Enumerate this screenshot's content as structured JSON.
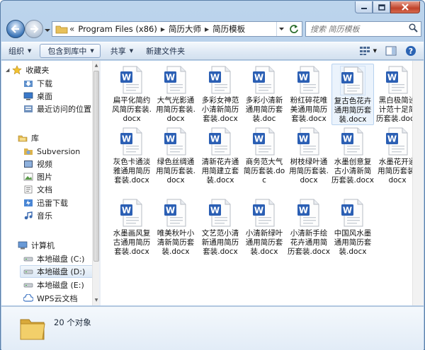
{
  "window": {
    "caption": {
      "minimize": "minimize",
      "maximize": "maximize",
      "close": "close"
    }
  },
  "address": {
    "segments": [
      "Program Files (x86)",
      "简历大师",
      "简历模板"
    ],
    "overflow": "«"
  },
  "search": {
    "placeholder": "搜索 简历模板"
  },
  "toolbar": {
    "organize": "组织",
    "include_in_library": "包含到库中",
    "share": "共享",
    "new_folder": "新建文件夹"
  },
  "nav": {
    "favorites": "收藏夹",
    "downloads": "下载",
    "desktop": "桌面",
    "recent": "最近访问的位置",
    "libraries": "库",
    "subversion": "Subversion",
    "videos": "视频",
    "pictures": "图片",
    "documents": "文档",
    "thunder": "迅雷下载",
    "music": "音乐",
    "computer": "计算机",
    "disk_c": "本地磁盘 (C:)",
    "disk_d": "本地磁盘 (D:)",
    "disk_e": "本地磁盘 (E:)",
    "wps": "WPS云文档"
  },
  "files": [
    "扁平化简约风简历套装.docx",
    "大气光影通用简历套装.docx",
    "多彩女神范小清新简历套装.docx",
    "多彩小清新通用简历套装.doc",
    "粉红碎花唯美通用简历套装.docx",
    "复古色花卉通用简历套装.docx",
    "黑白极简设计范十足简历套装.docx",
    "灰色卡通淡雅通用简历套装.docx",
    "绿色丝绸通用简历套装.docx",
    "清新花卉通用简建立套装.docx",
    "商务范大气简历套装.doc",
    "树枝绿叶通用简历套装.docx",
    "水墨创意复古小清新简历套装.docx",
    "水墨花开通用简历套装.docx",
    "水墨画风复古通用简历套装.docx",
    "唯美秋叶小清新简历套装.docx",
    "文艺范小清新通用简历套装.docx",
    "小清新绿叶通用简历套装.docx",
    "小清新手绘花卉通用简历套装.docx",
    "中国风水墨通用简历套装.docx"
  ],
  "details": {
    "count": "20 个对象"
  },
  "colors": {
    "word_blue": "#2b5fb4",
    "selection": "#cde3f8"
  }
}
